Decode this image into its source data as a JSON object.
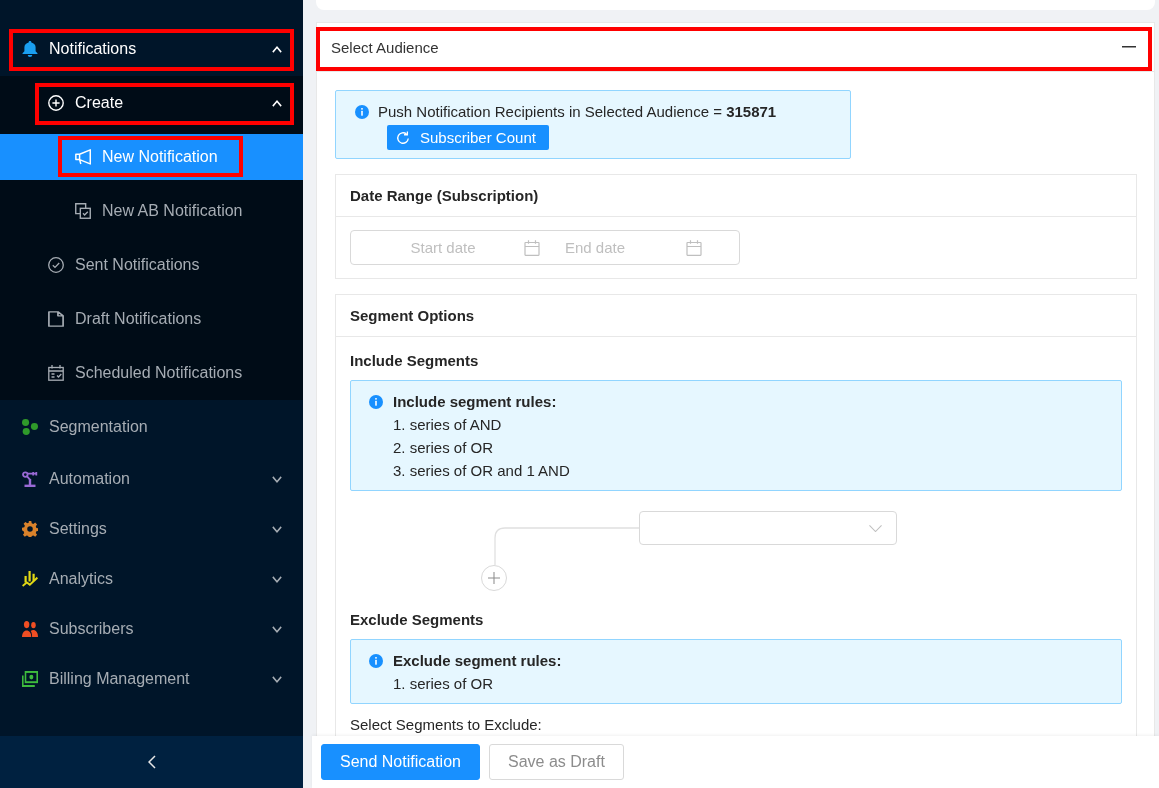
{
  "sidebar": {
    "items": [
      {
        "label": "Notifications",
        "kind": "submenu",
        "expanded": true,
        "selected": true,
        "highlighted": true,
        "color": "#1a9ff0",
        "children": [
          {
            "label": "Create",
            "kind": "submenu",
            "expanded": true,
            "selected": true,
            "highlighted": true,
            "children": [
              {
                "label": "New Notification",
                "kind": "item",
                "selected": true,
                "highlighted": true
              },
              {
                "label": "New AB Notification",
                "kind": "item",
                "selected": false,
                "highlighted": false
              }
            ]
          },
          {
            "label": "Sent Notifications",
            "kind": "item",
            "selected": false,
            "highlighted": false
          },
          {
            "label": "Draft Notifications",
            "kind": "item",
            "selected": false,
            "highlighted": false
          },
          {
            "label": "Scheduled Notifications",
            "kind": "item",
            "selected": false,
            "highlighted": false
          }
        ]
      },
      {
        "label": "Segmentation",
        "kind": "item",
        "selected": false,
        "highlighted": false,
        "color": "#2f9a2a"
      },
      {
        "label": "Automation",
        "kind": "submenu",
        "expanded": false,
        "selected": false,
        "highlighted": false,
        "color": "#9a6ad6"
      },
      {
        "label": "Settings",
        "kind": "submenu",
        "expanded": false,
        "selected": false,
        "highlighted": false,
        "color": "#d9822b"
      },
      {
        "label": "Analytics",
        "kind": "submenu",
        "expanded": false,
        "selected": false,
        "highlighted": false,
        "color": "#e2d915"
      },
      {
        "label": "Subscribers",
        "kind": "submenu",
        "expanded": false,
        "selected": false,
        "highlighted": false,
        "color": "#f04e23"
      },
      {
        "label": "Billing Management",
        "kind": "submenu",
        "expanded": false,
        "selected": false,
        "highlighted": false,
        "color": "#3dbb3d"
      }
    ]
  },
  "panel": {
    "title": "Select Audience",
    "expanded": true,
    "highlighted": true,
    "audience_alert": {
      "text": "Push Notification Recipients in Selected Audience = **315871**",
      "button": "Subscriber Count"
    },
    "date_range": {
      "title": "Date Range (Subscription)",
      "start_placeholder": "Start date",
      "end_placeholder": "End date"
    },
    "segment_options": {
      "title": "Segment Options",
      "include": {
        "title": "Include Segments",
        "rules_title": "Include segment rules:",
        "rules": [
          "1. series of AND",
          "2. series of OR",
          "3. series of OR and 1 AND"
        ]
      },
      "exclude": {
        "title": "Exclude Segments",
        "rules_title": "Exclude segment rules:",
        "rules": [
          "1. series of OR"
        ],
        "select_label": "Select Segments to Exclude:"
      }
    }
  },
  "footer": {
    "buttons": [
      {
        "label": "Send Notification",
        "kind": "primary"
      },
      {
        "label": "Save as Draft",
        "kind": "default"
      }
    ]
  }
}
